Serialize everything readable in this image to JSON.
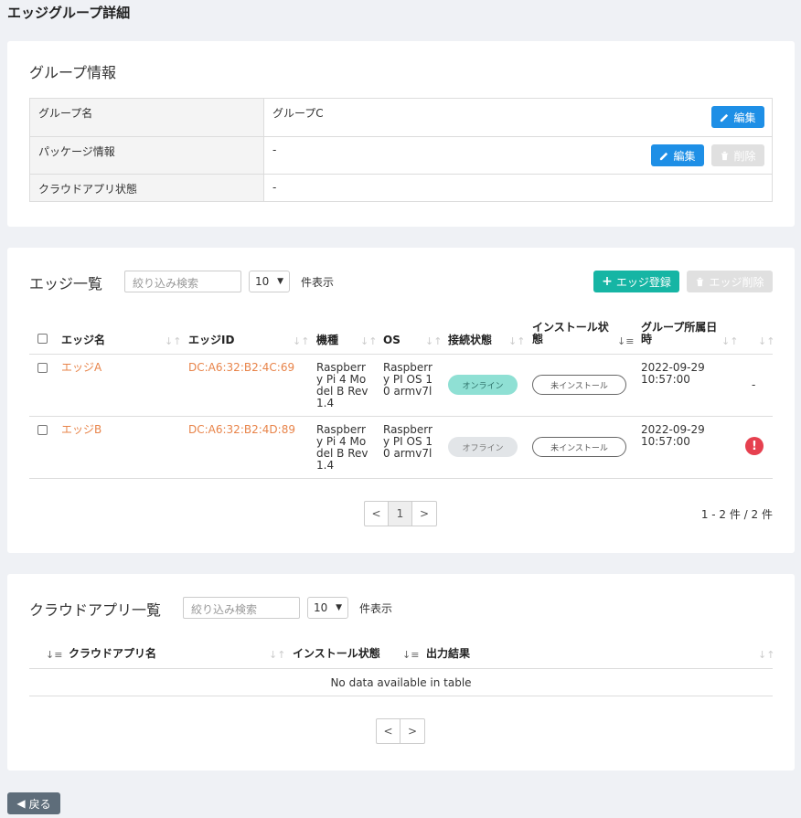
{
  "page": {
    "title": "エッジグループ詳細"
  },
  "group_info": {
    "title": "グループ情報",
    "rows": [
      {
        "key": "グループ名",
        "value": "グループC"
      },
      {
        "key": "パッケージ情報",
        "value": "-"
      },
      {
        "key": "クラウドアプリ状態",
        "value": "-"
      }
    ],
    "edit_label": "編集",
    "delete_label": "削除"
  },
  "edge_list": {
    "title": "エッジ一覧",
    "search_placeholder": "絞り込み検索",
    "page_size": "10",
    "per_page_label": "件表示",
    "register_label": "エッジ登録",
    "delete_label": "エッジ削除",
    "columns": [
      "エッジ名",
      "エッジID",
      "機種",
      "OS",
      "接続状態",
      "インストール状態",
      "グループ所属日時"
    ],
    "rows": [
      {
        "name": "エッジA",
        "id": "DC:A6:32:B2:4C:69",
        "model": [
          "Raspberr",
          "y Pi 4 Mo",
          "del B Rev",
          "1.4"
        ],
        "os": [
          "Raspberr",
          "y PI OS 1",
          "0 armv7l"
        ],
        "connection": "オンライン",
        "install": "未インストール",
        "joined": [
          "2022-09-29",
          "10:57:00"
        ],
        "extra": "-"
      },
      {
        "name": "エッジB",
        "id": "DC:A6:32:B2:4D:89",
        "model": [
          "Raspberr",
          "y Pi 4 Mo",
          "del B Rev",
          "1.4"
        ],
        "os": [
          "Raspberr",
          "y PI OS 1",
          "0 armv7l"
        ],
        "connection": "オフライン",
        "install": "未インストール",
        "joined": [
          "2022-09-29",
          "10:57:00"
        ],
        "extra": "!"
      }
    ],
    "pager": {
      "prev": "<",
      "page": "1",
      "next": ">"
    },
    "count_text": "1 - 2 件 / 2 件"
  },
  "cloud_apps": {
    "title": "クラウドアプリ一覧",
    "search_placeholder": "絞り込み検索",
    "page_size": "10",
    "per_page_label": "件表示",
    "columns": [
      "クラウドアプリ名",
      "インストール状態",
      "出力結果"
    ],
    "empty_text": "No data available in table",
    "pager": {
      "prev": "<",
      "next": ">"
    }
  },
  "footer": {
    "back_label": "戻る"
  },
  "colors": {
    "accent_blue": "#1e8fe6",
    "accent_teal": "#16b5a4",
    "link_orange": "#e8844a",
    "alert_red": "#e6404f"
  },
  "icons": [
    "pencil-icon",
    "trash-icon",
    "plus-icon",
    "sort-icon",
    "alert-icon",
    "back-arrow-icon"
  ]
}
